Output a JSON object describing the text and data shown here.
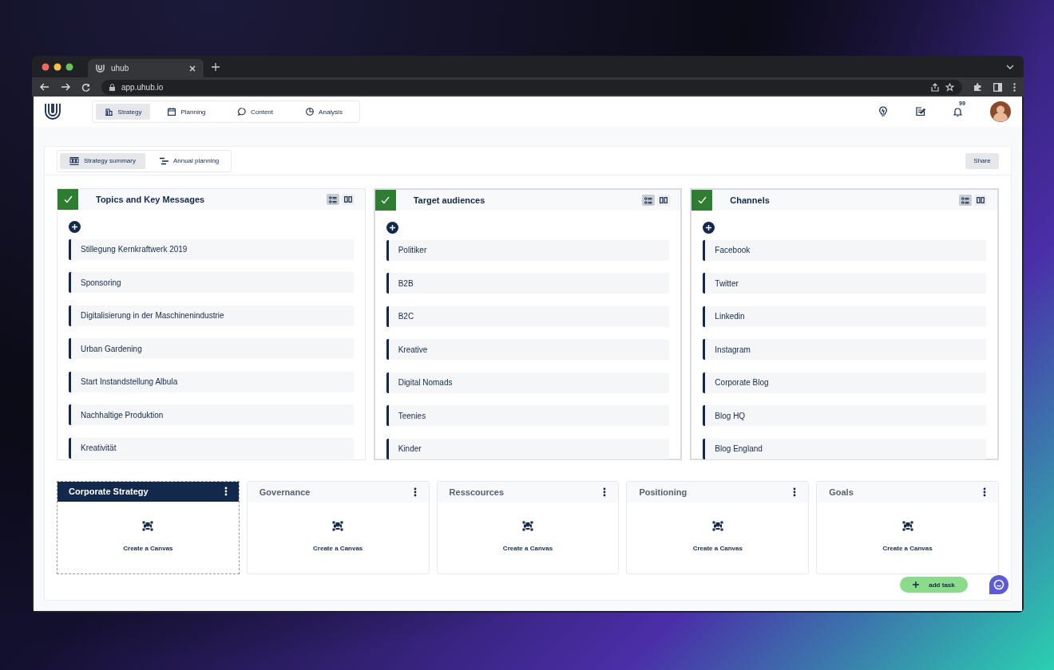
{
  "browser": {
    "tab_title": "uhub",
    "url": "app.uhub.io"
  },
  "nav": {
    "tabs": [
      {
        "label": "Strategy",
        "selected": true
      },
      {
        "label": "Planning",
        "selected": false
      },
      {
        "label": "Content",
        "selected": false
      },
      {
        "label": "Analysis",
        "selected": false
      }
    ],
    "notification_count": "99"
  },
  "subtabs": [
    {
      "label": "Strategy summary",
      "selected": true
    },
    {
      "label": "Annual planning",
      "selected": false
    }
  ],
  "share_button": "Share",
  "boards": [
    {
      "title": "Topics and Key Messages",
      "done": true,
      "items": [
        "Stillegung Kernkraftwerk 2019",
        "Sponsoring",
        "Digitalisierung in der Maschinenindustrie",
        "Urban Gardening",
        "Start Instandstellung Albula",
        "Nachhaltige Produktion",
        "Kreativität"
      ]
    },
    {
      "title": "Target audiences",
      "done": true,
      "items": [
        "Politiker",
        "B2B",
        "B2C",
        "Kreative",
        "Digital Nomads",
        "Teenies",
        "Kinder"
      ]
    },
    {
      "title": "Channels",
      "done": true,
      "items": [
        "Facebook",
        "Twitter",
        "Linkedin",
        "Instagram",
        "Corporate Blog",
        "Blog HQ",
        "Blog England"
      ]
    }
  ],
  "canvases": [
    {
      "title": "Corporate Strategy",
      "action": "Create a Canvas",
      "selected": true
    },
    {
      "title": "Governance",
      "action": "Create a Canvas",
      "selected": false
    },
    {
      "title": "Resscources",
      "action": "Create a Canvas",
      "selected": false
    },
    {
      "title": "Positioning",
      "action": "Create a Canvas",
      "selected": false
    },
    {
      "title": "Goals",
      "action": "Create a Canvas",
      "selected": false
    }
  ],
  "add_task_button": "add task"
}
